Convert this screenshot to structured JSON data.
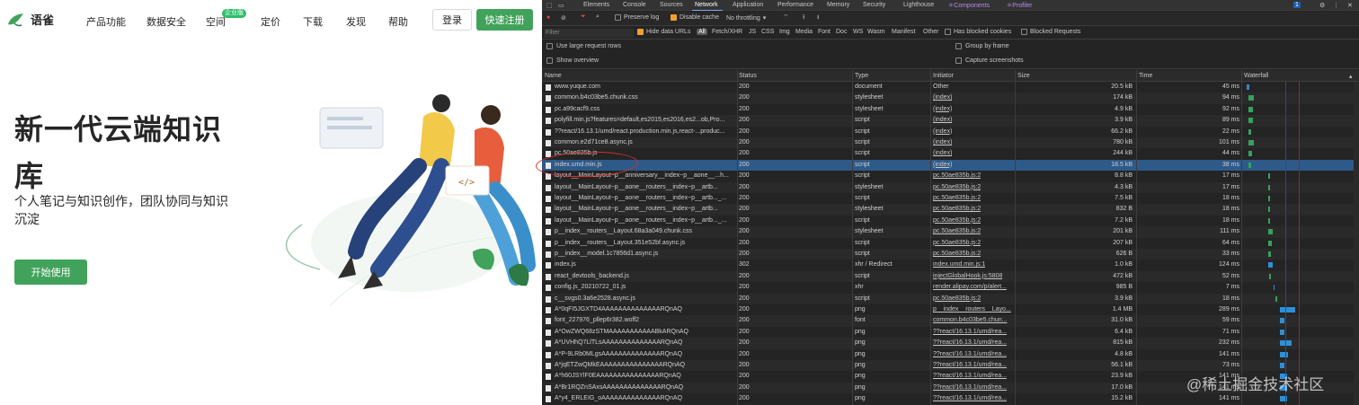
{
  "site": {
    "logo_text": "语雀",
    "nav": [
      "产品功能",
      "数据安全",
      "空间",
      "定价",
      "下载",
      "发现",
      "帮助"
    ],
    "space_badge": "企业版",
    "login": "登录",
    "signup": "快速注册",
    "hero_title": "新一代云端知识库",
    "hero_sub": "个人笔记与知识创作，团队协同与知识沉淀",
    "start": "开始使用",
    "brand_color": "#41a35b"
  },
  "devtools": {
    "tabs": [
      "Elements",
      "Console",
      "Sources",
      "Network",
      "Application",
      "Performance",
      "Memory",
      "Security",
      "Lighthouse",
      "Components",
      "Profiler"
    ],
    "active_tab": "Network",
    "notification_count": "1",
    "toolbar": {
      "preserve_log": "Preserve log",
      "disable_cache": "Disable cache",
      "throttling": "No throttling"
    },
    "filter_placeholder": "Filter",
    "hide_data_urls": "Hide data URLs",
    "all": "All",
    "types": [
      "Fetch/XHR",
      "JS",
      "CSS",
      "Img",
      "Media",
      "Font",
      "Doc",
      "WS",
      "Wasm",
      "Manifest",
      "Other"
    ],
    "has_blocked_cookies": "Has blocked cookies",
    "blocked_requests": "Blocked Requests",
    "options": {
      "large_rows": "Use large request rows",
      "overview": "Show overview",
      "group_by_frame": "Group by frame",
      "capture_screenshots": "Capture screenshots"
    },
    "columns": [
      "Name",
      "Status",
      "Type",
      "Initiator",
      "Size",
      "Time",
      "Waterfall"
    ],
    "rows": [
      {
        "name": "www.yuque.com",
        "status": "200",
        "type": "document",
        "initiator": "Other",
        "size": "20.5 kB",
        "time": "45 ms"
      },
      {
        "name": "common.b4c03be5.chunk.css",
        "status": "200",
        "type": "stylesheet",
        "initiator": "(index)",
        "size": "174 kB",
        "time": "94 ms"
      },
      {
        "name": "pc.a99cacf9.css",
        "status": "200",
        "type": "stylesheet",
        "initiator": "(index)",
        "size": "4.9 kB",
        "time": "92 ms"
      },
      {
        "name": "polyfill.min.js?features=default,es2015,es2016,es2...ob,Pro...",
        "status": "200",
        "type": "script",
        "initiator": "(index)",
        "size": "3.9 kB",
        "time": "89 ms"
      },
      {
        "name": "??react/16.13.1/umd/react.production.min.js,react-...produc...",
        "status": "200",
        "type": "script",
        "initiator": "(index)",
        "size": "66.2 kB",
        "time": "22 ms"
      },
      {
        "name": "common.e2d71ce8.async.js",
        "status": "200",
        "type": "script",
        "initiator": "(index)",
        "size": "780 kB",
        "time": "101 ms"
      },
      {
        "name": "pc.50ae835b.js",
        "status": "200",
        "type": "script",
        "initiator": "(index)",
        "size": "244 kB",
        "time": "44 ms"
      },
      {
        "name": "index.umd.min.js",
        "status": "200",
        "type": "script",
        "initiator": "(index)",
        "size": "18.5 kB",
        "time": "38 ms"
      },
      {
        "name": "layout__MainLayout~p__anniversary__index~p__aone__...h...",
        "status": "200",
        "type": "script",
        "initiator": "pc.50ae835b.js:2",
        "size": "8.8 kB",
        "time": "17 ms"
      },
      {
        "name": "layout__MainLayout~p__aone__routers__index~p__artb...",
        "status": "200",
        "type": "stylesheet",
        "initiator": "pc.50ae835b.js:2",
        "size": "4.3 kB",
        "time": "17 ms"
      },
      {
        "name": "layout__MainLayout~p__aone__routers__index~p__artb..._...",
        "status": "200",
        "type": "script",
        "initiator": "pc.50ae835b.js:2",
        "size": "7.5 kB",
        "time": "18 ms"
      },
      {
        "name": "layout__MainLayout~p__aone__routers__index~p__artb...",
        "status": "200",
        "type": "stylesheet",
        "initiator": "pc.50ae835b.js:2",
        "size": "832 B",
        "time": "18 ms"
      },
      {
        "name": "layout__MainLayout~p__aone__routers__index~p__artb..._...",
        "status": "200",
        "type": "script",
        "initiator": "pc.50ae835b.js:2",
        "size": "7.2 kB",
        "time": "18 ms"
      },
      {
        "name": "p__index__routers__Layout.68a3a049.chunk.css",
        "status": "200",
        "type": "stylesheet",
        "initiator": "pc.50ae835b.js:2",
        "size": "201 kB",
        "time": "111 ms"
      },
      {
        "name": "p__index__routers__Layout.351e52bf.async.js",
        "status": "200",
        "type": "script",
        "initiator": "pc.50ae835b.js:2",
        "size": "207 kB",
        "time": "64 ms"
      },
      {
        "name": "p__index__model.1c7856d1.async.js",
        "status": "200",
        "type": "script",
        "initiator": "pc.50ae835b.js:2",
        "size": "626 B",
        "time": "33 ms"
      },
      {
        "name": "index.js",
        "status": "302",
        "type": "xhr / Redirect",
        "initiator": "index.umd.min.js:1",
        "size": "1.0 kB",
        "time": "124 ms"
      },
      {
        "name": "react_devtools_backend.js",
        "status": "200",
        "type": "script",
        "initiator": "injectGlobalHook.js:5808",
        "size": "472 kB",
        "time": "52 ms"
      },
      {
        "name": "config.js_20210722_01.js",
        "status": "200",
        "type": "xhr",
        "initiator": "render.alipay.com/p/alert...",
        "size": "985 B",
        "time": "7 ms"
      },
      {
        "name": "c__svgs0.3a6e2528.async.js",
        "status": "200",
        "type": "script",
        "initiator": "pc.50ae835b.js:2",
        "size": "3.9 kB",
        "time": "18 ms"
      },
      {
        "name": "A*0qFI5JGXTD4AAAAAAAAAAAAAARQnAQ",
        "status": "200",
        "type": "png",
        "initiator": "p__index__routers__Layo...",
        "size": "1.4 MB",
        "time": "289 ms"
      },
      {
        "name": "font_227976_pllep6r382.woff2",
        "status": "200",
        "type": "font",
        "initiator": "common.b4c03be5.chun...",
        "size": "31.0 kB",
        "time": "59 ms"
      },
      {
        "name": "A*OwZWQ68zSTMAAAAAAAAAAABkARQnAQ",
        "status": "200",
        "type": "png",
        "initiator": "??react/16.13.1/umd/rea...",
        "size": "6.4 kB",
        "time": "71 ms"
      },
      {
        "name": "A*UVHhQ7LlTLsAAAAAAAAAAAAAARQnAQ",
        "status": "200",
        "type": "png",
        "initiator": "??react/16.13.1/umd/rea...",
        "size": "815 kB",
        "time": "232 ms"
      },
      {
        "name": "A*P-9LRb0MLgsAAAAAAAAAAAAAARQnAQ",
        "status": "200",
        "type": "png",
        "initiator": "??react/16.13.1/umd/rea...",
        "size": "4.8 kB",
        "time": "141 ms"
      },
      {
        "name": "A*jqETZwQMkEAAAAAAAAAAAAAAARQnAQ",
        "status": "200",
        "type": "png",
        "initiator": "??react/16.13.1/umd/rea...",
        "size": "56.1 kB",
        "time": "73 ms"
      },
      {
        "name": "A*h60JSYlF0EAAAAAAAAAAAAAAARQnAQ",
        "status": "200",
        "type": "png",
        "initiator": "??react/16.13.1/umd/rea...",
        "size": "23.9 kB",
        "time": "141 ms"
      },
      {
        "name": "A*Br1RQZnSAxsAAAAAAAAAAAAAARQnAQ",
        "status": "200",
        "type": "png",
        "initiator": "??react/16.13.1/umd/rea...",
        "size": "17.0 kB",
        "time": "141 ms"
      },
      {
        "name": "A*y4_ERLEIG_oAAAAAAAAAAAAAARQnAQ",
        "status": "200",
        "type": "png",
        "initiator": "??react/16.13.1/umd/rea...",
        "size": "15.2 kB",
        "time": "141 ms"
      }
    ],
    "selected_row": 7,
    "watermark": "@稀土掘金技术社区"
  }
}
